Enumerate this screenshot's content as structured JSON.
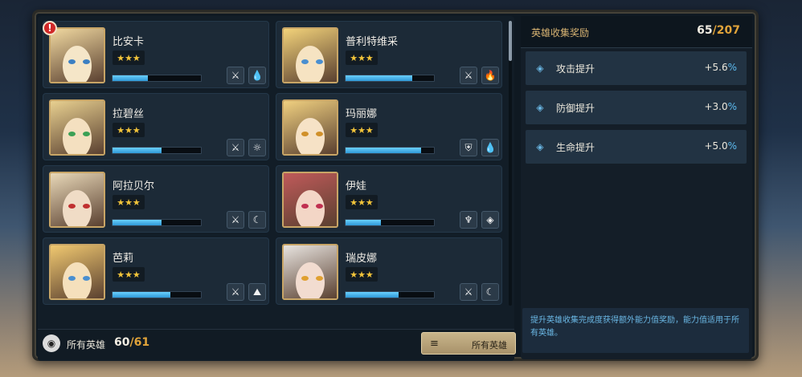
{
  "heroes": [
    {
      "name": "比安卡",
      "stars": "★★★",
      "progress": 0.4,
      "icons": [
        "⚔",
        "💧"
      ],
      "icon_names": [
        "sword-crossed-icon",
        "water-drop-icon"
      ],
      "portrait": [
        "#f0d8a0",
        "#f5e6c8",
        "#3b7fc2"
      ]
    },
    {
      "name": "普利特维采",
      "stars": "★★★",
      "progress": 0.75,
      "icons": [
        "⚔",
        "🔥"
      ],
      "icon_names": [
        "sword-crossed-icon",
        "fire-icon"
      ],
      "portrait": [
        "#f2d27a",
        "#f6e3c2",
        "#4a8fd0"
      ]
    },
    {
      "name": "拉碧丝",
      "stars": "★★★",
      "progress": 0.55,
      "icons": [
        "⚔",
        "☼"
      ],
      "icon_names": [
        "sword-crossed-icon",
        "sun-icon"
      ],
      "portrait": [
        "#e8d090",
        "#f4e0c0",
        "#3ba055"
      ]
    },
    {
      "name": "玛丽娜",
      "stars": "★★★",
      "progress": 0.85,
      "icons": [
        "⛨",
        "💧"
      ],
      "icon_names": [
        "shield-icon",
        "water-drop-icon"
      ],
      "portrait": [
        "#f0d080",
        "#f6e2c6",
        "#d0902a"
      ]
    },
    {
      "name": "阿拉贝尔",
      "stars": "★★★",
      "progress": 0.55,
      "icons": [
        "⚔",
        "☾"
      ],
      "icon_names": [
        "sword-crossed-icon",
        "moon-icon"
      ],
      "portrait": [
        "#e8d8b8",
        "#f0dcc6",
        "#c03030"
      ]
    },
    {
      "name": "伊娃",
      "stars": "★★★",
      "progress": 0.4,
      "icons": [
        "♆",
        "◈"
      ],
      "icon_names": [
        "staff-icon",
        "diamond-rune-icon"
      ],
      "portrait": [
        "#c05a5a",
        "#f3d6c6",
        "#c03050"
      ]
    },
    {
      "name": "芭莉",
      "stars": "★★★",
      "progress": 0.65,
      "icons": [
        "⚔",
        "⛰"
      ],
      "icon_names": [
        "sword-crossed-icon",
        "earth-icon"
      ],
      "portrait": [
        "#f0c870",
        "#f5e0bc",
        "#4a8fd0"
      ]
    },
    {
      "name": "瑞皮娜",
      "stars": "★★★",
      "progress": 0.6,
      "icons": [
        "⚔",
        "☾"
      ],
      "icon_names": [
        "sword-crossed-icon",
        "moon-icon"
      ],
      "portrait": [
        "#e8e4e0",
        "#f2dcd0",
        "#e0a030"
      ]
    }
  ],
  "footer": {
    "label": "所有英雄",
    "count_current": "60",
    "count_sep": "/",
    "count_total": "61",
    "filter_label": "所有英雄"
  },
  "bonus": {
    "title": "英雄收集奖励",
    "count_current": "65",
    "count_sep": "/",
    "count_total": "207",
    "stats": [
      {
        "name": "攻击提升",
        "value": "+5.6",
        "unit": "%"
      },
      {
        "name": "防御提升",
        "value": "+3.0",
        "unit": "%"
      },
      {
        "name": "生命提升",
        "value": "+5.0",
        "unit": "%"
      }
    ],
    "note": "提升英雄收集完成度获得额外能力值奖励，能力值适用于所有英雄。"
  }
}
